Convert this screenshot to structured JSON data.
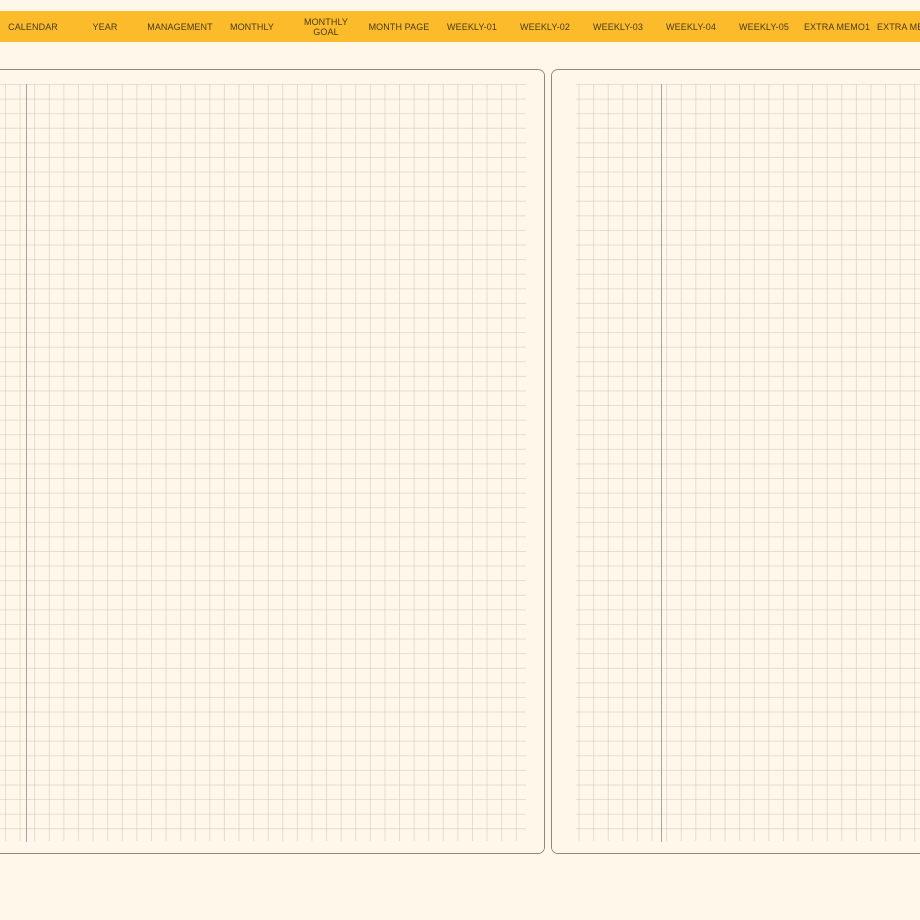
{
  "colors": {
    "tab_bar": "#fbbb2b",
    "tab_text": "#4a3a1a",
    "page_background": "#fff7ea",
    "page_border": "#8e8a78",
    "grid_line": "#cdc8b9",
    "margin_line": "#9ea7a6"
  },
  "tabs": [
    {
      "label": "CALENDAR"
    },
    {
      "label": "YEAR"
    },
    {
      "label": "MANAGEMENT"
    },
    {
      "label": "MONTHLY"
    },
    {
      "label": "MONTHLY\nGOAL"
    },
    {
      "label": "MONTH PAGE"
    },
    {
      "label": "WEEKLY-01"
    },
    {
      "label": "WEEKLY-02"
    },
    {
      "label": "WEEKLY-03"
    },
    {
      "label": "WEEKLY-04"
    },
    {
      "label": "WEEKLY-05"
    },
    {
      "label": "EXTRA MEMO1"
    },
    {
      "label": "EXTRA ME"
    }
  ]
}
